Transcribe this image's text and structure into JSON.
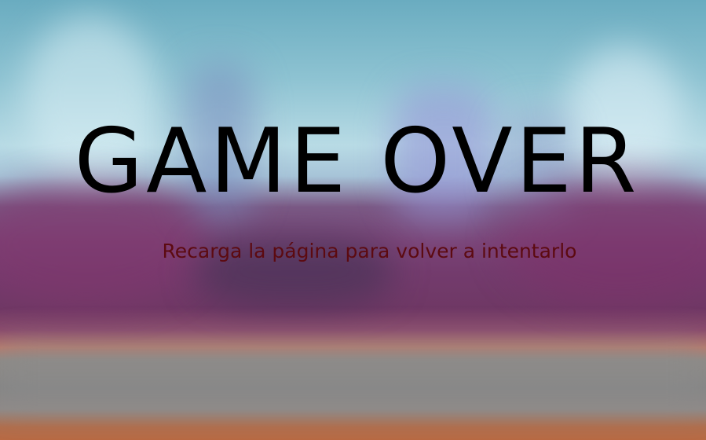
{
  "game_over": {
    "title": "GAME OVER",
    "message": "Recarga la página para volver a intentarlo"
  },
  "colors": {
    "title": "#000000",
    "message": "#5c0a10",
    "sky": "#8ec3d2",
    "foliage": "#733b6d",
    "road": "#858585"
  }
}
